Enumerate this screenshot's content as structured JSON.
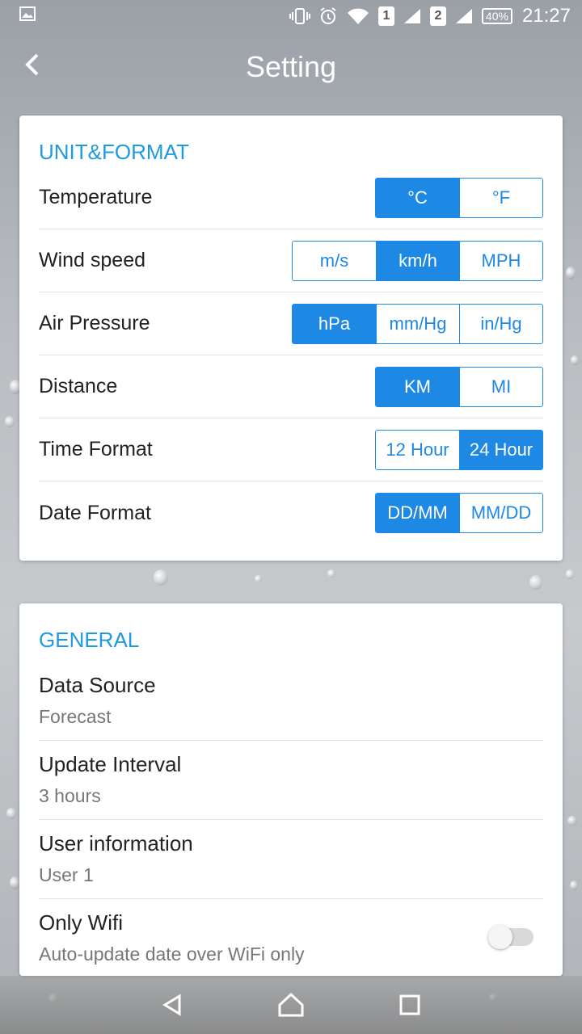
{
  "status": {
    "sim1": "1",
    "sim2": "2",
    "battery": "40%",
    "time": "21:27"
  },
  "header": {
    "title": "Setting"
  },
  "unit_format": {
    "section_title": "UNIT&FORMAT",
    "rows": [
      {
        "label": "Temperature",
        "options": [
          "°C",
          "°F"
        ],
        "selected": "°C"
      },
      {
        "label": "Wind speed",
        "options": [
          "m/s",
          "km/h",
          "MPH"
        ],
        "selected": "km/h"
      },
      {
        "label": "Air Pressure",
        "options": [
          "hPa",
          "mm/Hg",
          "in/Hg"
        ],
        "selected": "hPa"
      },
      {
        "label": "Distance",
        "options": [
          "KM",
          "MI"
        ],
        "selected": "KM"
      },
      {
        "label": "Time Format",
        "options": [
          "12 Hour",
          "24 Hour"
        ],
        "selected": "24 Hour"
      },
      {
        "label": "Date Format",
        "options": [
          "DD/MM",
          "MM/DD"
        ],
        "selected": "DD/MM"
      }
    ]
  },
  "general": {
    "section_title": "GENERAL",
    "items": [
      {
        "title": "Data Source",
        "subtitle": "Forecast"
      },
      {
        "title": "Update Interval",
        "subtitle": "3 hours"
      },
      {
        "title": "User information",
        "subtitle": "User 1"
      },
      {
        "title": "Only Wifi",
        "subtitle": "Auto-update date over WiFi only",
        "toggle": false
      }
    ]
  },
  "colors": {
    "accent": "#1e88e5",
    "section_title": "#1e9be0"
  }
}
